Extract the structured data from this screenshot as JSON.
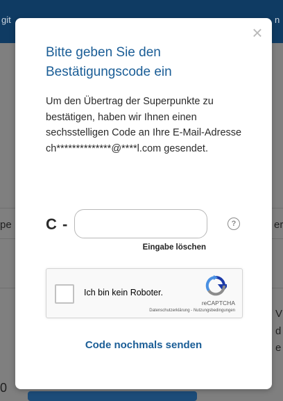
{
  "background": {
    "header_left": "git",
    "header_right": "n",
    "row_left": "pe",
    "row_right": "er",
    "right_chars": [
      "V",
      "d",
      "e"
    ],
    "left_char": "0"
  },
  "modal": {
    "close_icon": "×",
    "title": "Bitte geben Sie den Bestätigungscode ein",
    "description": "Um den Übertrag der Superpunkte zu bestätigen, haben wir Ihnen einen sechsstelligen Code an Ihre E-Mail-Adresse ch**************@****l.com gesendet.",
    "code_prefix": "C -",
    "code_cells": [
      "",
      "",
      "",
      "",
      "",
      ""
    ],
    "help_icon": "?",
    "clear_label": "Eingabe löschen",
    "captcha": {
      "label": "Ich bin kein Roboter.",
      "brand": "reCAPTCHA",
      "links": "Datenschutzerklärung - Nutzungsbedingungen"
    },
    "resend_label": "Code nochmals senden"
  },
  "colors": {
    "accent": "#1a5d96",
    "header": "#0f3b63",
    "overlay": "#7f7f7f"
  }
}
